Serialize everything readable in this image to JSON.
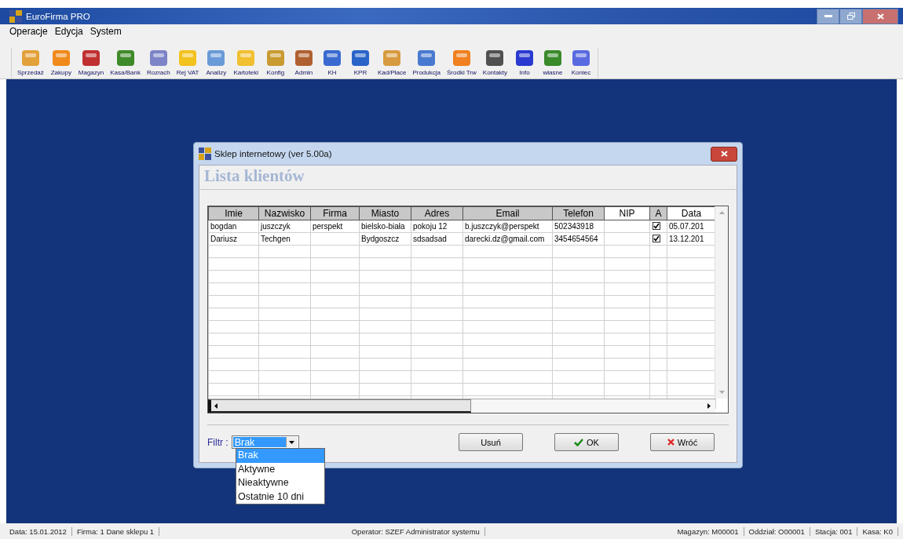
{
  "window": {
    "title": "EuroFirma PRO"
  },
  "menu": [
    "Operacje",
    "Edycja",
    "System"
  ],
  "toolbar": [
    "Sprzedaż",
    "Zakupy",
    "Magazyn",
    "Kasa/Bank",
    "Rozrach",
    "Rej VAT",
    "Analizy",
    "Kartoteki",
    "Konfig",
    "Admin",
    "KH",
    "KPR",
    "Kad/Płace",
    "Produkcja",
    "Środki Trw",
    "Kontakty",
    "Info",
    "własne",
    "Koniec"
  ],
  "dialog": {
    "title": "Sklep internetowy (ver 5.00a)",
    "heading": "Lista klientów",
    "table": {
      "columns": [
        "Imie",
        "Nazwisko",
        "Firma",
        "Miasto",
        "Adres",
        "Email",
        "Telefon",
        "NIP",
        "A",
        "Data"
      ],
      "rows": [
        {
          "imie": "bogdan",
          "nazwisko": "juszczyk",
          "firma": "perspekt",
          "miasto": "bielsko-biała",
          "adres": "pokoju 12",
          "email": "b.juszczyk@perspekt",
          "telefon": "502343918",
          "a": true,
          "data": "05.07.201"
        },
        {
          "imie": "Dariusz",
          "nazwisko": "Techgen",
          "firma": "",
          "miasto": "Bydgoszcz",
          "adres": "sdsadsad",
          "email": "darecki.dz@gmail.com",
          "telefon": "3454654564",
          "a": true,
          "data": "13.12.201"
        }
      ]
    },
    "filter": {
      "label": "Filtr :",
      "value": "Brak",
      "options": [
        {
          "label": "Brak",
          "selected": true
        },
        {
          "label": "Aktywne",
          "selected": false
        },
        {
          "label": "Nieaktywne",
          "selected": false
        },
        {
          "label": "Ostatnie 10 dni",
          "selected": false
        }
      ]
    },
    "buttons": [
      {
        "kind": "delete",
        "label": "Usuń"
      },
      {
        "kind": "ok",
        "label": "OK"
      },
      {
        "kind": "back",
        "label": "Wróć"
      }
    ]
  },
  "status_bar": {
    "left": [
      "Data: 15.01.2012",
      "Firma: 1 Dane sklepu 1"
    ],
    "center": "Operator: SZEF Administrator systemu",
    "right": [
      "Magazyn: M00001",
      "Oddział: O00001",
      "Stacja: 001",
      "Kasa: K0"
    ]
  }
}
